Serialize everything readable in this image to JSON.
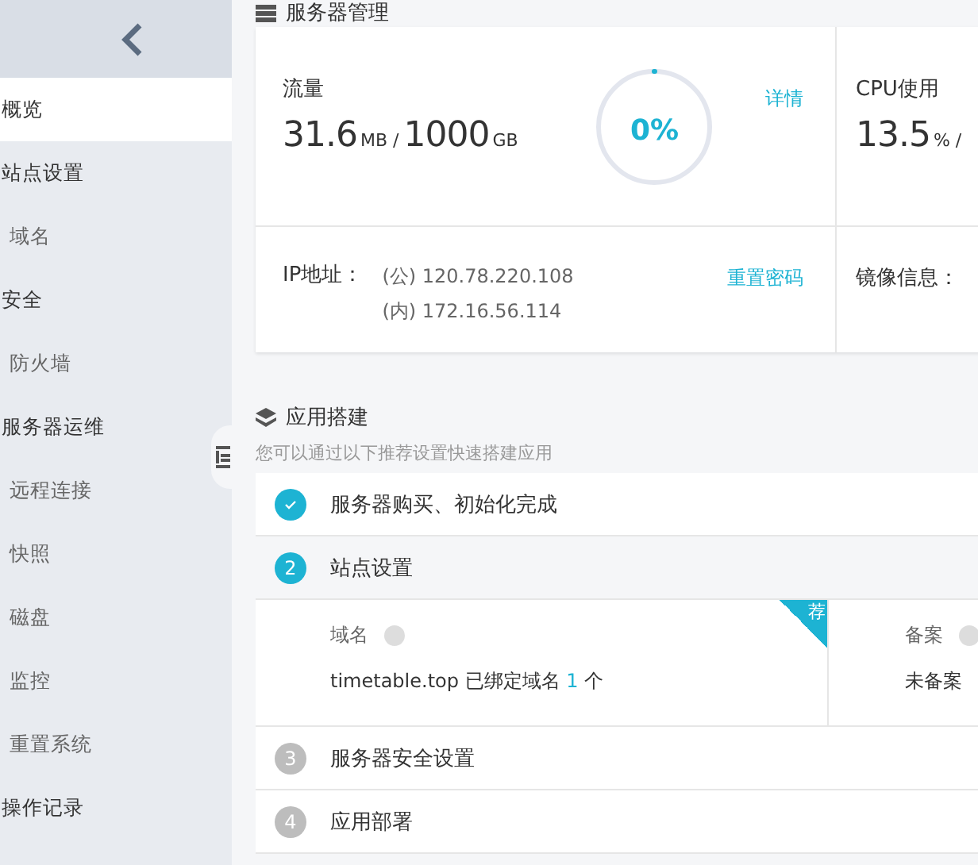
{
  "sidebar": {
    "items": [
      {
        "label": "概览",
        "selected": true
      },
      {
        "label": "站点设置",
        "selected": false,
        "children": [
          {
            "label": "域名",
            "selected": false
          }
        ]
      },
      {
        "label": "安全",
        "selected": false,
        "children": [
          {
            "label": "防火墙",
            "selected": false
          }
        ]
      },
      {
        "label": "服务器运维",
        "selected": false,
        "children": [
          {
            "label": "远程连接",
            "selected": false
          },
          {
            "label": "快照",
            "selected": false
          },
          {
            "label": "磁盘",
            "selected": false
          },
          {
            "label": "监控",
            "selected": false
          },
          {
            "label": "重置系统",
            "selected": false
          }
        ]
      },
      {
        "label": "操作记录",
        "selected": false
      }
    ]
  },
  "server": {
    "title": "服务器管理",
    "traffic": {
      "label": "流量",
      "used": "31.6",
      "used_unit": "MB /",
      "total": "1000",
      "total_unit": "GB",
      "gauge_text": "0%",
      "level": 0,
      "link": "详情"
    },
    "cpu": {
      "label": "CPU使用",
      "value": "13.5",
      "unit": "% /"
    },
    "ip": {
      "label": "IP地址：",
      "public": "(公) 120.78.220.108",
      "private": "(内) 172.16.56.114",
      "link": "重置密码"
    },
    "image": {
      "label": "镜像信息："
    }
  },
  "setup": {
    "title": "应用搭建",
    "subtitle": "您可以通过以下推荐设置快速搭建应用",
    "steps": [
      {
        "label": "服务器购买、初始化完成",
        "kind": "done"
      },
      {
        "number": "2",
        "label": "站点设置",
        "kind": "active",
        "details": [
          {
            "label": "域名",
            "value": "timetable.top 已绑定域名 **1** 个",
            "ribbon": "荐"
          },
          {
            "label": "备案",
            "value": "未备案"
          }
        ]
      },
      {
        "number": "3",
        "label": "服务器安全设置",
        "kind": "pending"
      },
      {
        "number": "4",
        "label": "应用部署",
        "kind": "pending"
      }
    ]
  }
}
